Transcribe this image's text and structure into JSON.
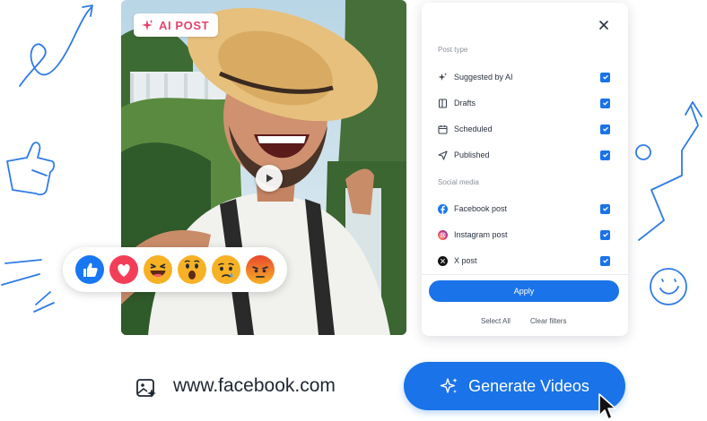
{
  "badge": {
    "label": "AI POST",
    "icon": "sparkle-icon"
  },
  "reactions": [
    {
      "name": "like",
      "icon": "thumbs-up-icon",
      "color": "#1877f2"
    },
    {
      "name": "love",
      "icon": "heart-icon",
      "color": "#f33e58"
    },
    {
      "name": "haha",
      "icon": "laugh-icon",
      "color": "#f7b125"
    },
    {
      "name": "wow",
      "icon": "wow-icon",
      "color": "#f7b125"
    },
    {
      "name": "sad",
      "icon": "sad-icon",
      "color": "#f7b125"
    },
    {
      "name": "angry",
      "icon": "angry-icon",
      "color": "#e9710f"
    }
  ],
  "filter_panel": {
    "post_type_label": "Post type",
    "post_types": [
      {
        "label": "Suggested by AI",
        "icon": "sparkle-icon",
        "checked": true
      },
      {
        "label": "Drafts",
        "icon": "draft-icon",
        "checked": true
      },
      {
        "label": "Scheduled",
        "icon": "calendar-icon",
        "checked": true
      },
      {
        "label": "Published",
        "icon": "send-icon",
        "checked": true
      }
    ],
    "social_media_label": "Social media",
    "social_media": [
      {
        "label": "Facebook post",
        "icon": "facebook-icon",
        "checked": true
      },
      {
        "label": "Instagram post",
        "icon": "instagram-icon",
        "checked": true
      },
      {
        "label": "X post",
        "icon": "x-icon",
        "checked": true
      }
    ],
    "apply_label": "Apply",
    "select_all_label": "Select All",
    "clear_filters_label": "Clear filters"
  },
  "bottom_bar": {
    "url": "www.facebook.com",
    "generate_label": "Generate Videos"
  },
  "colors": {
    "accent": "#1a73e8",
    "badge_text": "#e2446e",
    "doodle": "#2f7be6"
  }
}
